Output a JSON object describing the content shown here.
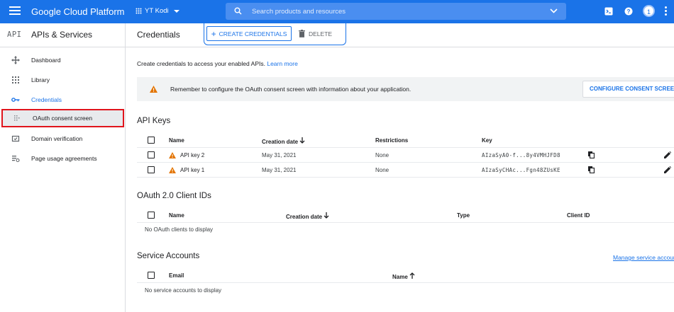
{
  "topbar": {
    "brand": "Google Cloud Platform",
    "project": "YT Kodi",
    "search_placeholder": "Search products and resources",
    "avatar_initial": "1",
    "colors": {
      "bar": "#1a73e8",
      "accent": "#1a73e8",
      "warning": "#e37400"
    }
  },
  "sidebar": {
    "logo": "API",
    "title": "APIs & Services",
    "items": [
      {
        "label": "Dashboard",
        "icon": "dashboard-icon"
      },
      {
        "label": "Library",
        "icon": "library-icon"
      },
      {
        "label": "Credentials",
        "icon": "key-icon"
      },
      {
        "label": "OAuth consent screen",
        "icon": "consent-icon"
      },
      {
        "label": "Domain verification",
        "icon": "domain-icon"
      },
      {
        "label": "Page usage agreements",
        "icon": "agreements-icon"
      }
    ]
  },
  "header": {
    "title": "Credentials",
    "create_label": "CREATE CREDENTIALS",
    "delete_label": "DELETE"
  },
  "main": {
    "intro": "Create credentials to access your enabled APIs.",
    "learn_more": "Learn more",
    "banner": {
      "message": "Remember to configure the OAuth consent screen with information about your application.",
      "button": "CONFIGURE CONSENT SCREEN"
    },
    "api_keys": {
      "title": "API Keys",
      "columns": {
        "name": "Name",
        "created": "Creation date",
        "restrictions": "Restrictions",
        "key": "Key"
      },
      "rows": [
        {
          "name": "API key 2",
          "created": "May 31, 2021",
          "restrictions": "None",
          "key": "AIzaSyA0-f...8y4VMHJFD8"
        },
        {
          "name": "API key 1",
          "created": "May 31, 2021",
          "restrictions": "None",
          "key": "AIzaSyCHAc...Fgn48ZUsKE"
        }
      ]
    },
    "oauth": {
      "title": "OAuth 2.0 Client IDs",
      "columns": {
        "name": "Name",
        "created": "Creation date",
        "type": "Type",
        "client_id": "Client ID"
      },
      "empty": "No OAuth clients to display"
    },
    "service": {
      "title": "Service Accounts",
      "manage": "Manage service accounts",
      "columns": {
        "email": "Email",
        "name": "Name"
      },
      "empty": "No service accounts to display"
    }
  }
}
